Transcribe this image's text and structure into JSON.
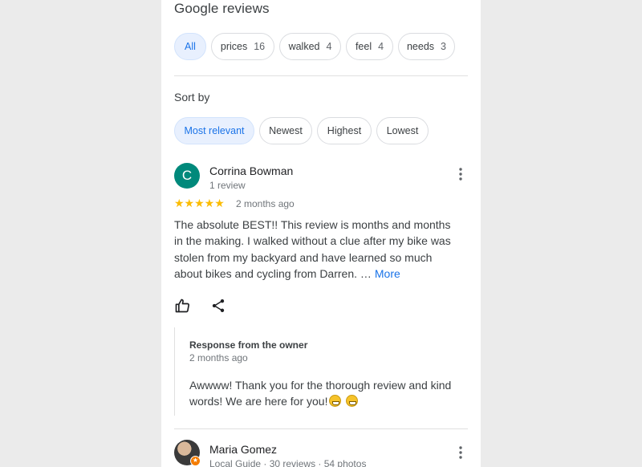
{
  "section": {
    "title": "Google reviews"
  },
  "topics": [
    {
      "label": "All",
      "count": "",
      "active": true
    },
    {
      "label": "prices",
      "count": "16"
    },
    {
      "label": "walked",
      "count": "4"
    },
    {
      "label": "feel",
      "count": "4"
    },
    {
      "label": "needs",
      "count": "3"
    }
  ],
  "sort": {
    "label": "Sort by",
    "options": [
      "Most relevant",
      "Newest",
      "Highest",
      "Lowest"
    ],
    "selected": "Most relevant"
  },
  "reviews": [
    {
      "initial": "C",
      "avatar_color": "#00897b",
      "name": "Corrina Bowman",
      "meta": "1 review",
      "stars": "★★★★★",
      "rating": 5,
      "time": "2 months ago",
      "text": "The absolute BEST!! This review is months and months in the making. I walked without a clue after my bike was stolen from my backyard and have learned so much about bikes and cycling from Darren. …",
      "more_label": "More",
      "owner_response": {
        "title": "Response from the owner",
        "time": "2 months ago",
        "text": "Awwww! Thank you for the thorough review and kind words! We are here for you!"
      }
    },
    {
      "name": "Maria Gomez",
      "meta": "Local Guide · 30 reviews · 54 photos"
    }
  ],
  "icons": {
    "like": "thumbs-up-icon",
    "share": "share-icon",
    "menu": "more-vert-icon",
    "emoji": "grinning-face-emoji"
  },
  "colors": {
    "accent": "#1a73e8",
    "star": "#fbbc04",
    "chip_active_bg": "#e8f0fe"
  }
}
